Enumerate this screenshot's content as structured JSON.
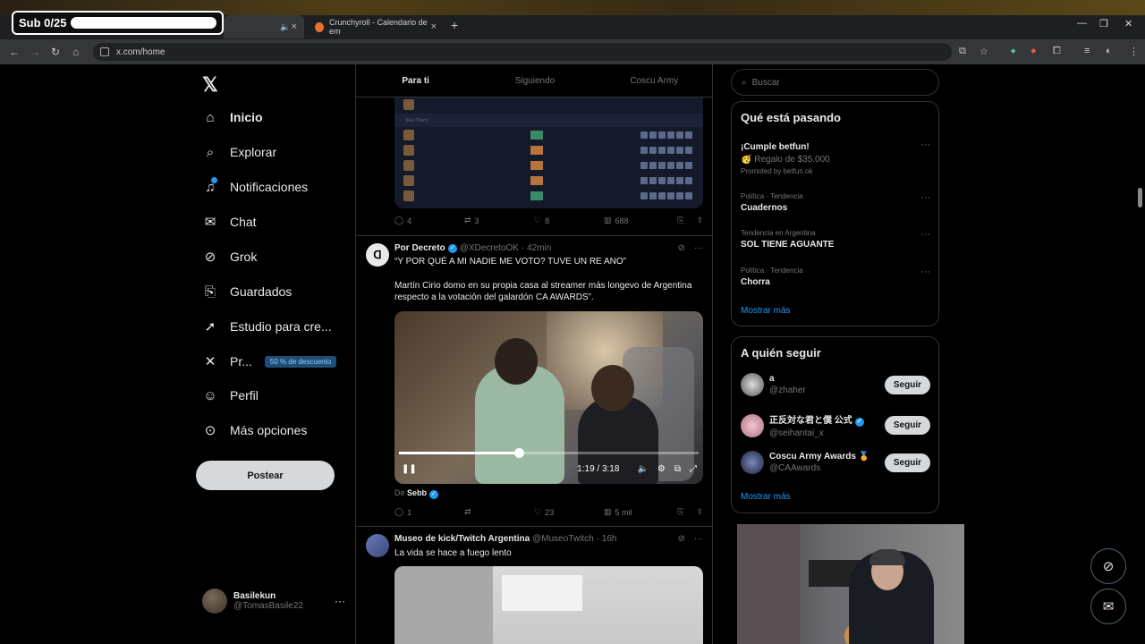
{
  "overlay": {
    "sub_counter": "Sub 0/25"
  },
  "browser": {
    "tabs": [
      {
        "label": ""
      },
      {
        "label": "Crunchyroll - Calendario de em"
      }
    ],
    "url": "x.com/home"
  },
  "nav": {
    "items": [
      {
        "label": "Inicio",
        "icon": "home-icon"
      },
      {
        "label": "Explorar",
        "icon": "search-icon"
      },
      {
        "label": "Notificaciones",
        "icon": "bell-icon"
      },
      {
        "label": "Chat",
        "icon": "mail-icon"
      },
      {
        "label": "Grok",
        "icon": "grok-icon"
      },
      {
        "label": "Guardados",
        "icon": "bookmark-icon"
      },
      {
        "label": "Estudio para cre...",
        "icon": "rocket-icon"
      },
      {
        "label": "Pr...",
        "icon": "x-premium-icon",
        "badge": "50 % de descuento"
      },
      {
        "label": "Perfil",
        "icon": "person-icon"
      },
      {
        "label": "Más opciones",
        "icon": "more-circle-icon"
      }
    ],
    "post_button": "Postear",
    "account": {
      "name": "Basilekun",
      "handle": "@TomasBasile22"
    }
  },
  "feed": {
    "tabs": [
      "Para ti",
      "Siguiendo",
      "Coscu Army"
    ],
    "tweet1": {
      "replies": "4",
      "reposts": "3",
      "likes": "8",
      "views": "688"
    },
    "tweet2": {
      "author": "Por Decreto",
      "handle": "@XDecretoOK",
      "time": "· 42min",
      "text1": "“Y POR QUÉ A MI NADIE ME VOTO? TUVE UN RE ANO”",
      "text2": "Martín Cirio domo en su propia casa al streamer más longevo de Argentina respecto a la votación del galardón CA AWARDS”.",
      "video_time": "1:19 / 3:18",
      "video_progress": 0.4,
      "from_prefix": "De",
      "from_name": "Sebb",
      "replies": "1",
      "reposts": "",
      "likes": "23",
      "views": "5 mil"
    },
    "tweet3": {
      "author": "Museo de kick/Twitch Argentina",
      "handle": "@MuseoTwitch",
      "time": "· 16h",
      "text": "La vida se hace a fuego lento"
    }
  },
  "sidebar": {
    "search_placeholder": "Buscar",
    "trends_title": "Qué está pasando",
    "trends": [
      {
        "context": "",
        "title": "¡Cumple betfun!",
        "sub": "🥳 Regalo de $35.000",
        "promo": "Promoted by betfun.ok"
      },
      {
        "context": "Política · Tendencia",
        "title": "Cuadernos"
      },
      {
        "context": "Tendencia en Argentina",
        "title": "SOL TIENE AGUANTE"
      },
      {
        "context": "Política · Tendencia",
        "title": "Chorra"
      }
    ],
    "show_more": "Mostrar más",
    "follow_title": "A quién seguir",
    "follow": [
      {
        "name": "a",
        "handle": "@zhaher",
        "button": "Seguir"
      },
      {
        "name": "正反対な君と僕 公式",
        "handle": "@seihantai_x",
        "button": "Seguir"
      },
      {
        "name": "Coscu Army Awards 🏅",
        "handle": "@CAAwards",
        "button": "Seguir"
      }
    ],
    "follow_more": "Mostrar más"
  },
  "colors": {
    "accent": "#1d9bf0",
    "background": "#000000",
    "border": "#2f3336",
    "muted": "#71767b"
  }
}
